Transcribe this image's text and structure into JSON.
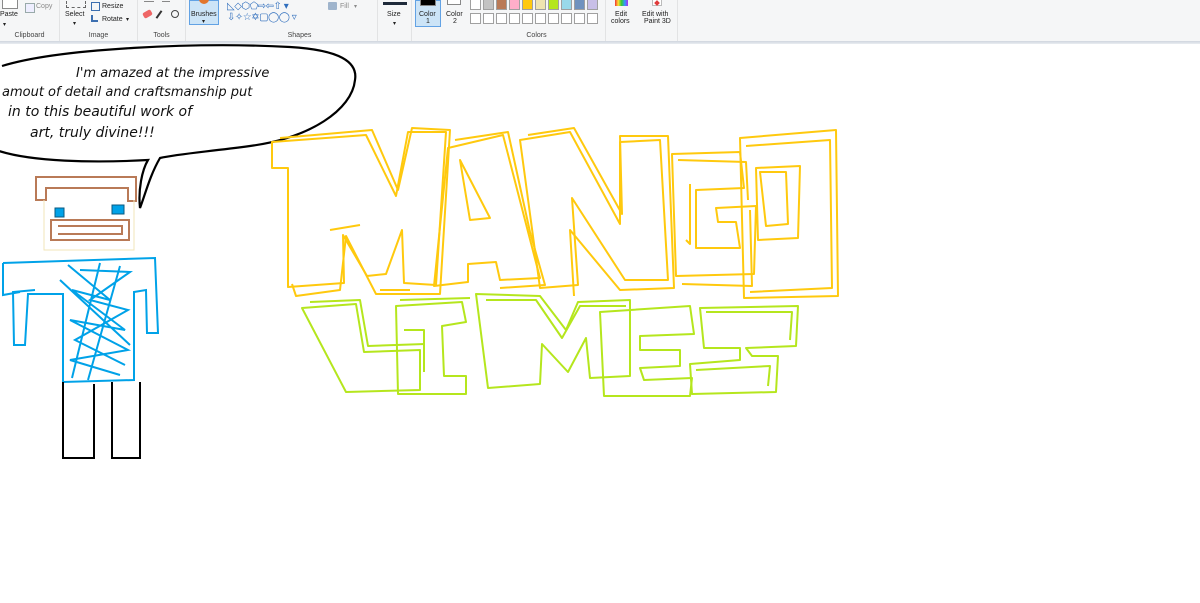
{
  "ribbon": {
    "clipboard": {
      "label": "Clipboard",
      "paste": "Paste",
      "copy": "Copy"
    },
    "image": {
      "label": "Image",
      "select": "Select",
      "resize": "Resize",
      "rotate": "Rotate"
    },
    "tools": {
      "label": "Tools"
    },
    "brushes": {
      "label": "Brushes"
    },
    "shapes": {
      "label": "Shapes",
      "fill": "Fill"
    },
    "size": {
      "label": "Size"
    },
    "color1": {
      "line1": "Color",
      "line2": "1"
    },
    "color2": {
      "line1": "Color",
      "line2": "2"
    },
    "colors": {
      "label": "Colors"
    },
    "edit_colors": {
      "line1": "Edit",
      "line2": "colors"
    },
    "edit_paint3d": {
      "line1": "Edit with",
      "line2": "Paint 3D"
    }
  },
  "palette": {
    "color1": "#000000",
    "color2": "#ffffff",
    "swatches_top": [
      "#ffffff",
      "#c3c3c3",
      "#b97a57",
      "#ffaec9",
      "#ffc90e",
      "#efe4b0",
      "#b5e61d",
      "#99d9ea",
      "#7092be",
      "#c8bfe7"
    ],
    "swatches_bottom": [
      "#ffffff",
      "#ffffff",
      "#ffffff",
      "#ffffff",
      "#ffffff",
      "#ffffff",
      "#ffffff",
      "#ffffff",
      "#ffffff",
      "#ffffff"
    ]
  },
  "drawing": {
    "speech_lines": [
      "I'm amazed at the impressive",
      "amout of detail and craftsmanship put",
      "in to this beautiful work of",
      "art, truly divine!!!"
    ],
    "title_top": "MANGO",
    "title_bottom": "LIMES",
    "colors": {
      "mango": "#ffc90e",
      "limes": "#b5e61d",
      "shirt": "#00a2e8",
      "hair": "#b97a57",
      "legs": "#000000",
      "eyes": "#00a2e8"
    }
  }
}
